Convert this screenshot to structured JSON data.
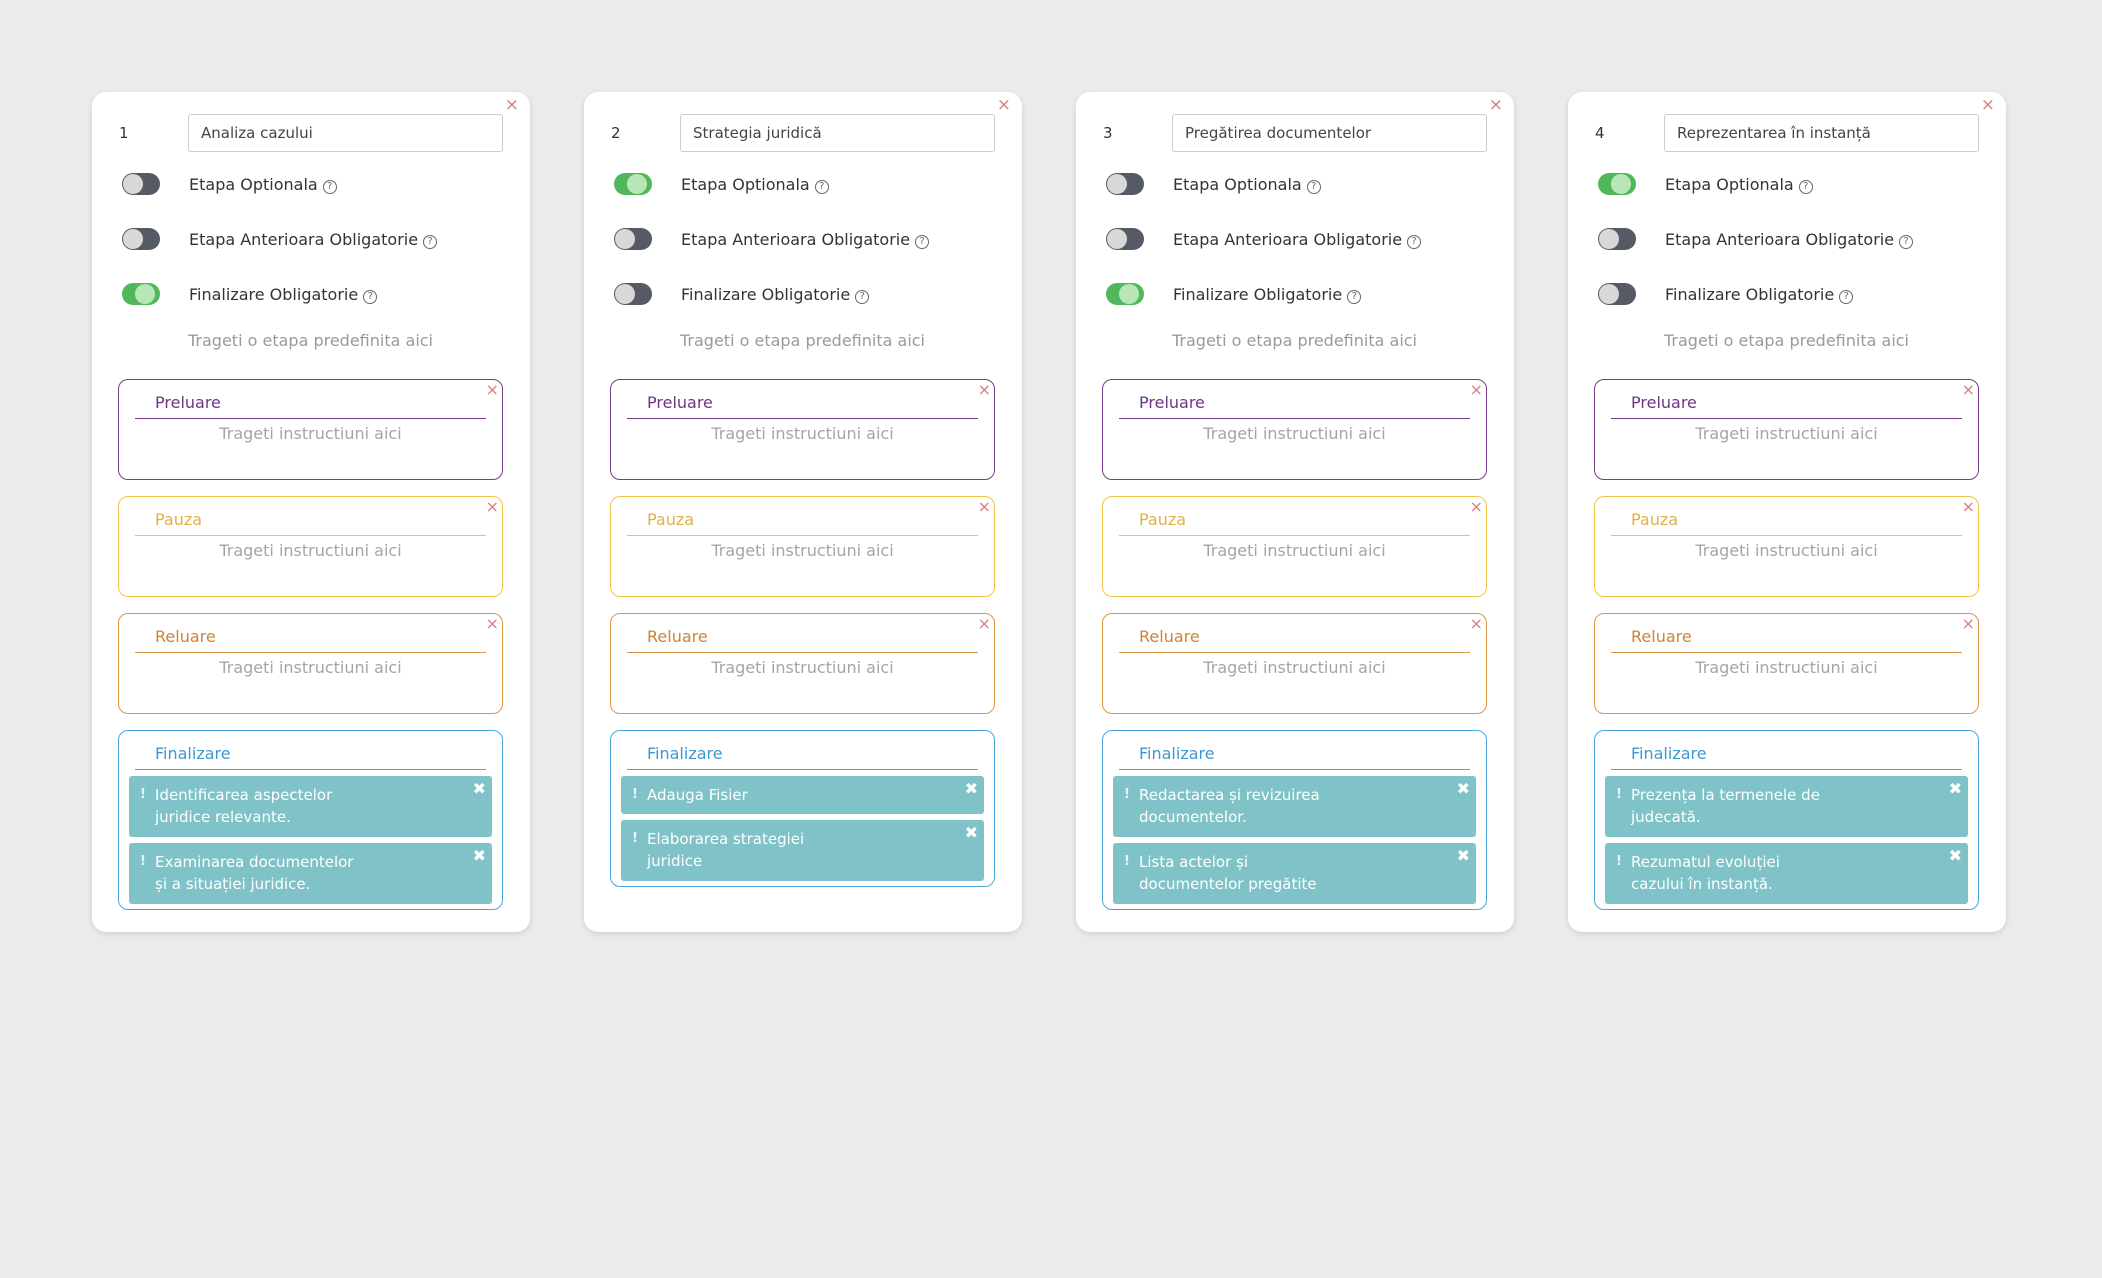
{
  "labels": {
    "optional": "Etapa Optionala",
    "prev_required": "Etapa Anterioara Obligatorie",
    "finish_required": "Finalizare Obligatorie",
    "drop_stage_hint": "Trageti o etapa predefinita aici",
    "drop_instr_hint": "Trageti instructiuni aici",
    "help_glyph": "?",
    "close_glyph": "×",
    "task_close_glyph": "✖",
    "task_bullet": "!"
  },
  "sections": {
    "preluare": "Preluare",
    "pauza": "Pauza",
    "reluare": "Reluare",
    "finalizare": "Finalizare"
  },
  "colors": {
    "preluare": "#7a3b8f",
    "pauza": "#f0c44a",
    "reluare": "#de9746",
    "finalizare": "#4aa7dd",
    "task_bg": "#7fc2c7",
    "toggle_on": "#52b75a",
    "toggle_off": "#555a64"
  },
  "stages": [
    {
      "number": "1",
      "name": "Analiza cazului",
      "optional": false,
      "prev_required": false,
      "finish_required": true,
      "tasks": [
        "Identificarea aspectelor\njuridice relevante.",
        "Examinarea documentelor\nși a situației juridice."
      ]
    },
    {
      "number": "2",
      "name": "Strategia juridică",
      "optional": true,
      "prev_required": false,
      "finish_required": false,
      "tasks": [
        "Adauga Fisier",
        "Elaborarea strategiei\njuridice"
      ]
    },
    {
      "number": "3",
      "name": "Pregătirea documentelor",
      "optional": false,
      "prev_required": false,
      "finish_required": true,
      "tasks": [
        "Redactarea și revizuirea\ndocumentelor.",
        "Lista actelor și\ndocumentelor pregătite"
      ]
    },
    {
      "number": "4",
      "name": "Reprezentarea în instanță",
      "optional": true,
      "prev_required": false,
      "finish_required": false,
      "tasks": [
        "Prezența la termenele de\njudecată.",
        "Rezumatul evoluției\ncazului în instanță."
      ]
    }
  ]
}
